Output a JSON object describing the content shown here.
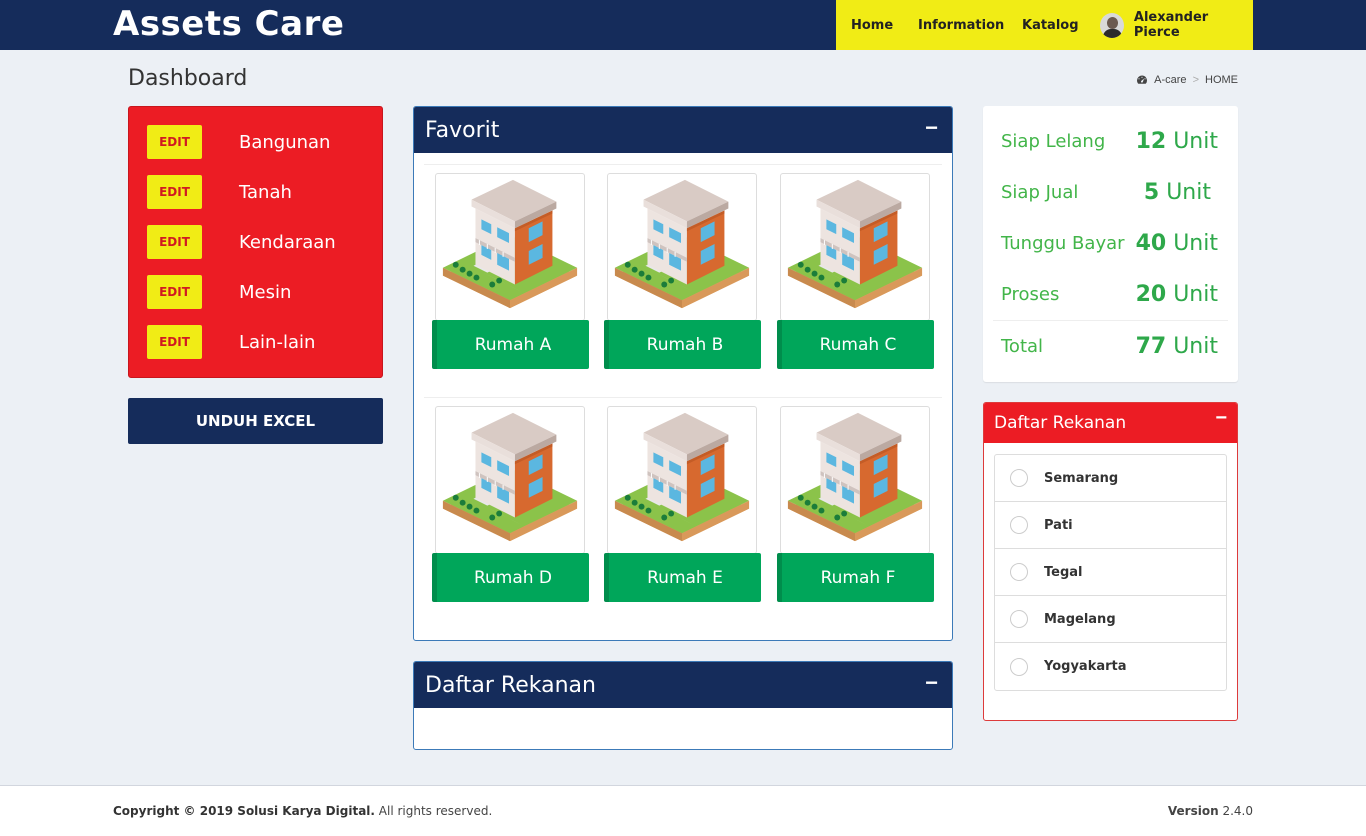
{
  "header": {
    "brand": "Assets Care",
    "nav": {
      "home": "Home",
      "information": "Information",
      "katalog": "Katalog"
    },
    "user_name": "Alexander Pierce"
  },
  "page": {
    "title": "Dashboard",
    "breadcrumb": {
      "root": "A-care",
      "separator": ">",
      "current": "HOME"
    }
  },
  "categories": {
    "edit_label": "EDIT",
    "items": [
      "Bangunan",
      "Tanah",
      "Kendaraan",
      "Mesin",
      "Lain-lain"
    ]
  },
  "excel_button": "UNDUH EXCEL",
  "favorit": {
    "title": "Favorit",
    "collapse": "−",
    "items": [
      "Rumah A",
      "Rumah B",
      "Rumah C",
      "Rumah D",
      "Rumah E",
      "Rumah F"
    ]
  },
  "rekanan_panel": {
    "title": "Daftar Rekanan",
    "collapse": "−"
  },
  "stats": [
    {
      "label": "Siap Lelang",
      "value": "12",
      "unit": "Unit"
    },
    {
      "label": "Siap Jual",
      "value": "5",
      "unit": "Unit"
    },
    {
      "label": "Tunggu Bayar",
      "value": "40",
      "unit": "Unit"
    },
    {
      "label": "Proses",
      "value": "20",
      "unit": "Unit"
    },
    {
      "label": "Total",
      "value": "77",
      "unit": "Unit"
    }
  ],
  "rekanan_list": {
    "title": "Daftar Rekanan",
    "collapse": "−",
    "items": [
      "Semarang",
      "Pati",
      "Tegal",
      "Magelang",
      "Yogyakarta"
    ]
  },
  "footer": {
    "copyright_prefix": "Copyright © 2019 Solusi Karya Digital.",
    "copyright_suffix": " All rights reserved.",
    "version_label": "Version",
    "version_value": " 2.4.0"
  },
  "colors": {
    "navy": "#152c5b",
    "yellow": "#f1ec15",
    "red": "#ec1c24",
    "green": "#00a65a",
    "stat_green": "#42b549"
  }
}
